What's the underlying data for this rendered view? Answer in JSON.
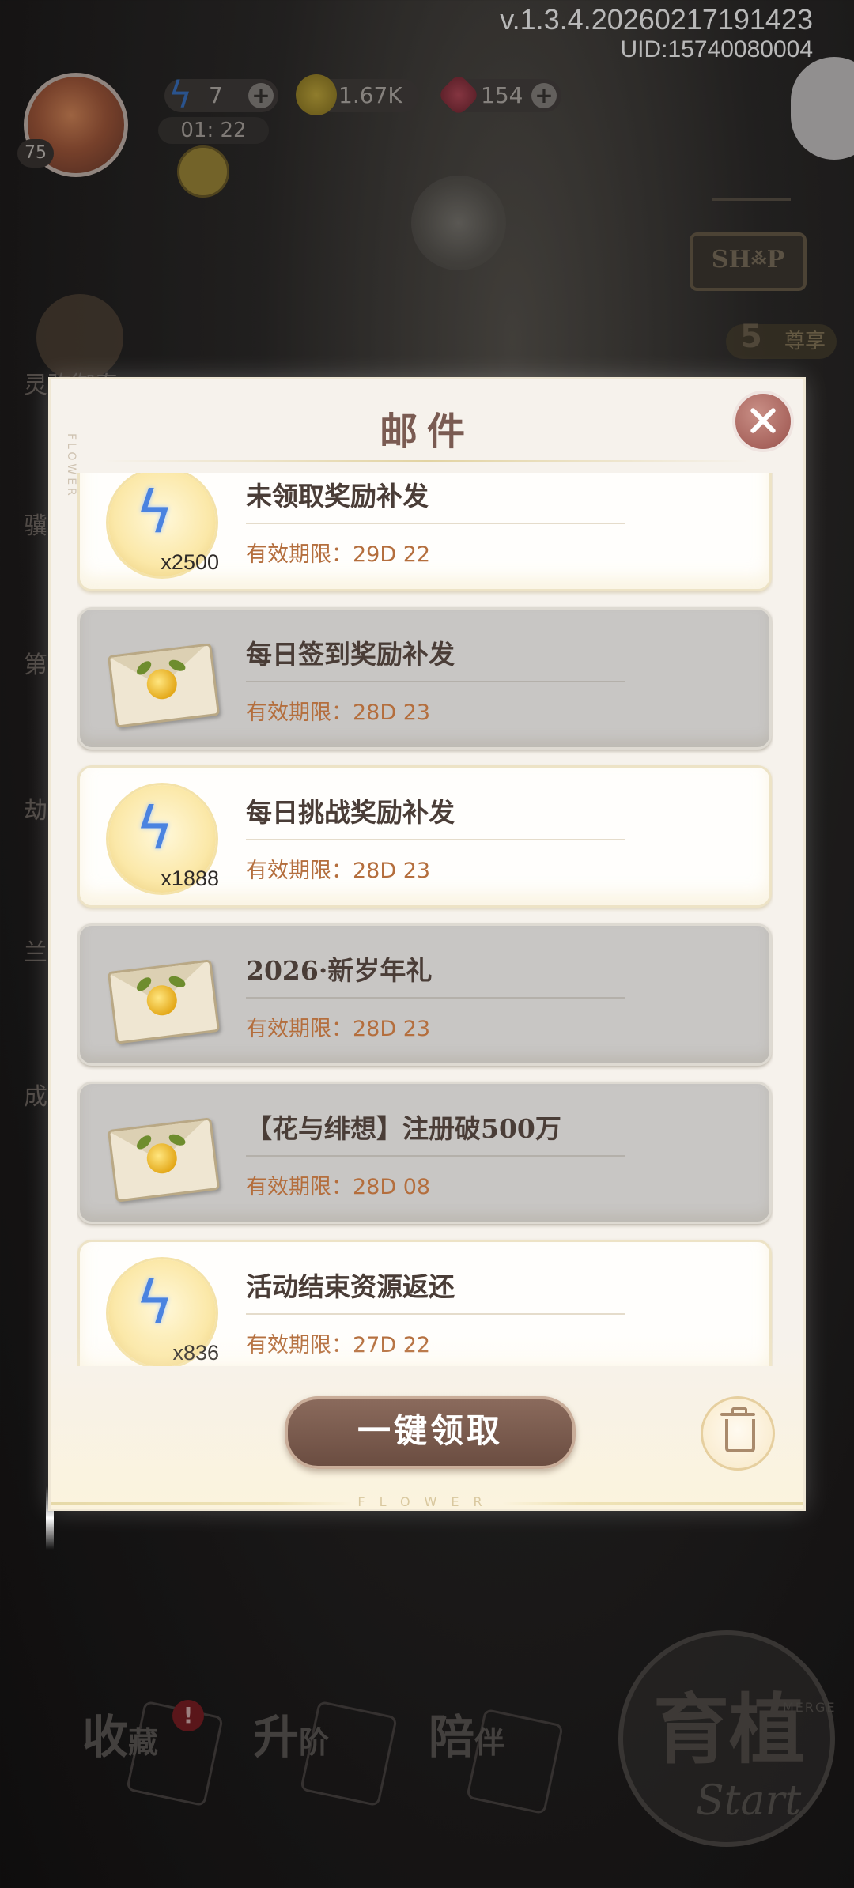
{
  "header": {
    "version": "v.1.3.4.20260217191423",
    "uid": "UID:15740080004"
  },
  "player": {
    "level": "75",
    "energy": "7",
    "gold": "1.67K",
    "gems": "154",
    "energy_timer": "01: 22"
  },
  "background": {
    "shop_sign": "SH࿏P",
    "vip_level": "5",
    "vip_label": "尊享",
    "left_labels": [
      "灵驹御春",
      "骥",
      "第",
      "劫",
      "兰",
      "成"
    ],
    "start_label": "育植",
    "start_merge": "MERGE",
    "start_script": "Start",
    "nav": [
      {
        "label": "收",
        "label2": "藏"
      },
      {
        "label": "升",
        "label2": "阶"
      },
      {
        "label": "陪",
        "label2": "伴"
      }
    ],
    "nav_badge": "!"
  },
  "dialog": {
    "title": "邮件",
    "side_deco": "FLOWER",
    "footer_deco": "FLOWER",
    "claim_all_label": "一键领取",
    "mails": [
      {
        "name": "未领取奖励补发",
        "expiry": "有效期限：29D 22",
        "kind": "reward",
        "qty": "x2500",
        "read": false
      },
      {
        "name": "每日签到奖励补发",
        "expiry": "有效期限：28D 23",
        "kind": "letter",
        "qty": "",
        "read": true
      },
      {
        "name": "每日挑战奖励补发",
        "expiry": "有效期限：28D 23",
        "kind": "reward",
        "qty": "x1888",
        "read": false
      },
      {
        "name": "2026·新岁年礼",
        "expiry": "有效期限：28D 23",
        "kind": "letter",
        "qty": "",
        "read": true
      },
      {
        "name": "【花与绯想】注册破500万",
        "expiry": "有效期限：28D 08",
        "kind": "letter",
        "qty": "",
        "read": true
      },
      {
        "name": "活动结束资源返还",
        "expiry": "有效期限：27D 22",
        "kind": "reward",
        "qty": "x836",
        "read": false
      }
    ]
  }
}
